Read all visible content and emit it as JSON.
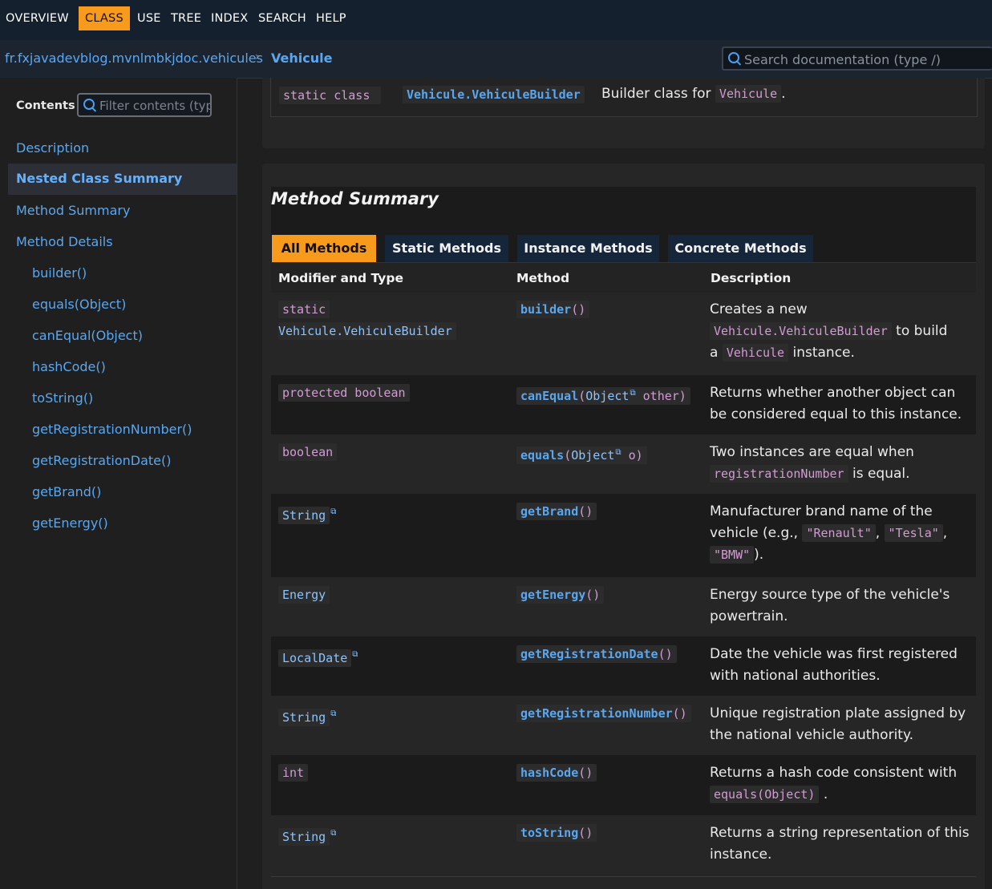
{
  "topnav": {
    "items": [
      "OVERVIEW",
      "CLASS",
      "USE",
      "TREE",
      "INDEX",
      "SEARCH",
      "HELP"
    ],
    "active": "CLASS"
  },
  "breadcrumb": {
    "package": "fr.fxjavadevblog.mvnlmbkjdoc.vehicules",
    "separator": "›",
    "class": "Vehicule"
  },
  "search": {
    "placeholder": "Search documentation (type /)"
  },
  "sidebar": {
    "contents_label": "Contents",
    "filter_placeholder": "Filter contents (type .)",
    "items": [
      {
        "label": "Description"
      },
      {
        "label": "Nested Class Summary"
      },
      {
        "label": "Method Summary"
      },
      {
        "label": "Method Details"
      },
      {
        "label": "builder()"
      },
      {
        "label": "equals(Object)"
      },
      {
        "label": "canEqual(Object)"
      },
      {
        "label": "hashCode()"
      },
      {
        "label": "toString()"
      },
      {
        "label": "getRegistrationNumber()"
      },
      {
        "label": "getRegistrationDate()"
      },
      {
        "label": "getBrand()"
      },
      {
        "label": "getEnergy()"
      }
    ],
    "active": "Nested Class Summary"
  },
  "nested": {
    "modifier": "static class",
    "name": "Vehicule.VehiculeBuilder",
    "desc_prefix": "Builder class for",
    "desc_code": "Vehicule",
    "desc_suffix": "."
  },
  "method_summary": {
    "title": "Method Summary",
    "tabs": [
      "All Methods",
      "Static Methods",
      "Instance Methods",
      "Concrete Methods"
    ],
    "active_tab": "All Methods",
    "columns": [
      "Modifier and Type",
      "Method",
      "Description"
    ],
    "rows": [
      {
        "mod": "static",
        "type": "Vehicule.VehiculeBuilder",
        "method": "builder",
        "params": "()",
        "desc": [
          "Creates a new",
          "Vehicule.VehiculeBuilder",
          "to build",
          "a",
          "Vehicule",
          "instance."
        ]
      },
      {
        "mod": "protected boolean",
        "method": "canEqual",
        "p_open": "(",
        "p_type": "Object",
        "p_name": " other)",
        "desc": [
          "Returns whether another object can",
          "be considered equal to this instance."
        ]
      },
      {
        "mod": "boolean",
        "method": "equals",
        "p_open": "(",
        "p_type": "Object",
        "p_name": " o)",
        "desc": [
          "Two instances are equal when",
          "registrationNumber",
          "is equal."
        ]
      },
      {
        "type": "String",
        "method": "getBrand",
        "params": "()",
        "desc": [
          "Manufacturer brand name of the",
          "vehicle (e.g.,",
          "\"Renault\"",
          ",",
          "\"Tesla\"",
          ",",
          "\"BMW\"",
          ")."
        ]
      },
      {
        "type": "Energy",
        "method": "getEnergy",
        "params": "()",
        "desc": [
          "Energy source type of the vehicle's",
          "powertrain."
        ]
      },
      {
        "type": "LocalDate",
        "method": "getRegistrationDate",
        "params": "()",
        "desc": [
          "Date the vehicle was first registered",
          "with national authorities."
        ]
      },
      {
        "type": "String",
        "method": "getRegistrationNumber",
        "params": "()",
        "desc": [
          "Unique registration plate assigned by",
          "the national vehicle authority."
        ]
      },
      {
        "type": "int",
        "method": "hashCode",
        "params": "()",
        "desc": [
          "Returns a hash code consistent with",
          "equals(Object)",
          "."
        ]
      },
      {
        "type": "String",
        "method": "toString",
        "params": "()",
        "desc": [
          "Returns a string representation of this",
          "instance."
        ]
      }
    ]
  },
  "icons": {
    "external_link": "external-link-icon",
    "search": "search-icon"
  }
}
